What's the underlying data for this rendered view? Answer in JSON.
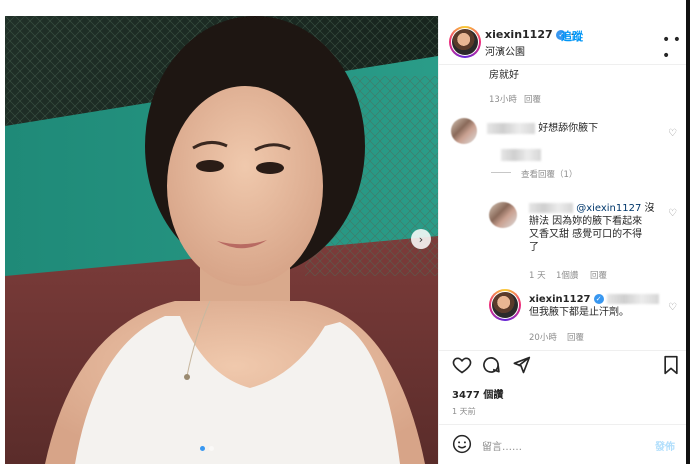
{
  "post": {
    "username": "xiexin1127",
    "follow_label": "追蹤",
    "location": "河濱公園",
    "more_icon": "more-options-icon"
  },
  "comments": {
    "c0_text": "房就好",
    "c0_time": "13小時",
    "c0_reply": "回覆",
    "c1_text": "好想舔你腋下",
    "c1_view_replies": "查看回覆（1）",
    "r1_mention": "@xiexin1127",
    "r1_text_1": "沒",
    "r1_text_2": "辦法 因為妳的腋下看起來",
    "r1_text_3": "又香又甜 感覺可口的不得",
    "r1_text_4": "了",
    "r1_time": "1 天",
    "r1_likes": "1個讚",
    "r1_reply": "回覆",
    "r2_user": "xiexin1127",
    "r2_text": "但我腋下都是止汗劑。",
    "r2_time": "20小時",
    "r2_reply": "回覆"
  },
  "actions": {
    "likes": "3477 個讚",
    "posted": "1 天前",
    "comment_placeholder": "留言……",
    "post_label": "發佈"
  },
  "colors": {
    "accent": "#0095f6",
    "verified": "#3897f0",
    "muted": "#8e8e8e",
    "text": "#262626"
  }
}
